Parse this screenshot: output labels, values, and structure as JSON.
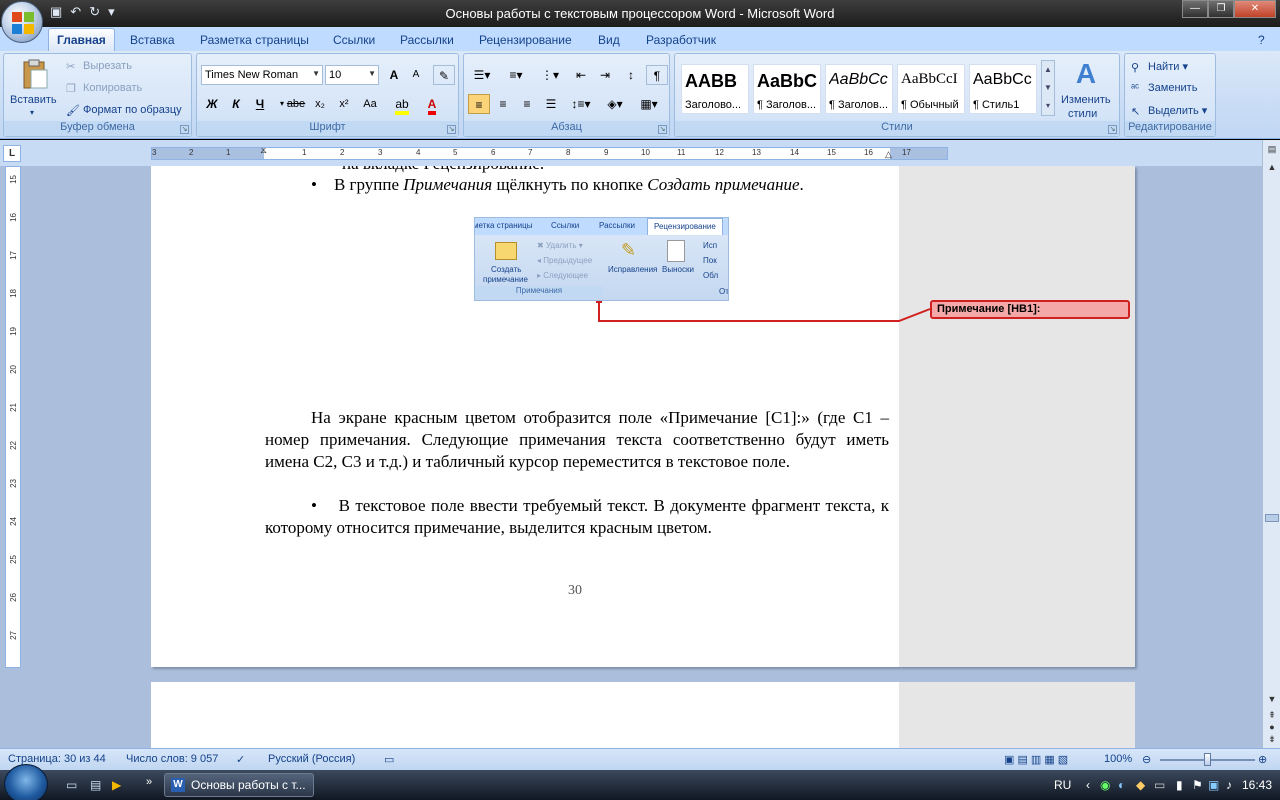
{
  "window": {
    "title": "Основы работы с текстовым процессором Word - Microsoft Word",
    "controls": {
      "minimize": "—",
      "maximize": "❐",
      "close": "✕"
    }
  },
  "ribbon": {
    "tabs": [
      "Главная",
      "Вставка",
      "Разметка страницы",
      "Ссылки",
      "Рассылки",
      "Рецензирование",
      "Вид",
      "Разработчик"
    ],
    "active_tab": "Главная",
    "clipboard": {
      "paste": "Вставить",
      "cut": "Вырезать",
      "copy": "Копировать",
      "format_painter": "Формат по образцу",
      "label": "Буфер обмена"
    },
    "font": {
      "font_name": "Times New Roman",
      "font_size": "10",
      "bold": "Ж",
      "italic": "К",
      "underline": "Ч",
      "strike": "abe",
      "subscript": "x₂",
      "superscript": "x²",
      "change_case": "Aa",
      "grow": "A",
      "shrink": "A",
      "label": "Шрифт"
    },
    "paragraph": {
      "label": "Абзац"
    },
    "styles": {
      "items": [
        {
          "preview": "AABB",
          "caption": "Заголово..."
        },
        {
          "preview": "AaBbC",
          "caption": "¶ Заголов..."
        },
        {
          "preview": "AaBbCc",
          "caption": "¶ Заголов..."
        },
        {
          "preview": "AaBbCcI",
          "caption": "¶ Обычный"
        },
        {
          "preview": "AaBbCc",
          "caption": "¶ Стиль1"
        }
      ],
      "change_styles_1": "Изменить",
      "change_styles_2": "стили",
      "label": "Стили"
    },
    "editing": {
      "find": "Найти",
      "replace": "Заменить",
      "select": "Выделить",
      "label": "Редактирование"
    }
  },
  "ruler": {
    "corner": "L",
    "ticks": [
      "3",
      "2",
      "1",
      "1",
      "2",
      "3",
      "4",
      "5",
      "6",
      "7",
      "8",
      "9",
      "10",
      "11",
      "12",
      "13",
      "14",
      "15",
      "16",
      "17"
    ],
    "vticks": [
      "15",
      "16",
      "17",
      "18",
      "19",
      "20",
      "21",
      "22",
      "23",
      "24",
      "25",
      "26",
      "27"
    ]
  },
  "document": {
    "cut_line": "на вкладке Рецензирование.",
    "bullet1_prefix": "В группе ",
    "bullet1_group": "Примечания",
    "bullet1_mid": " щёлкнуть по кнопке ",
    "bullet1_button": "Создать примечание",
    "bullet1_end": ".",
    "paragraph": "На экране красным цветом отобразится поле «Примечание [С1]:» (где С1 – номер примечания. Следующие примечания текста соответственно будут иметь имена С2, С3 и т.д.) и табличный курсор переместится в текстовое поле.",
    "bullet2": "В текстовое поле ввести требуемый текст. В документе фрагмент текста, к которому относится примечание, выделится красным цветом.",
    "page_number": "30",
    "bullet_glyph": "•"
  },
  "embedded_ribbon": {
    "tabs": [
      "метка страницы",
      "Ссылки",
      "Рассылки",
      "Рецензирование"
    ],
    "create_1": "Создать",
    "create_2": "примечание",
    "delete": "Удалить",
    "previous": "Предыдущее",
    "next": "Следующее",
    "group": "Примечания",
    "track": "Исправления",
    "balloons": "Выноски",
    "cut1": "Исп",
    "cut2": "Пок",
    "cut3": "Обл",
    "cut4": "От"
  },
  "comment": {
    "label": "Примечание [НВ1]:"
  },
  "statusbar": {
    "page": "Страница: 30 из 44",
    "words": "Число слов: 9 057",
    "language": "Русский (Россия)",
    "zoom": "100%"
  },
  "taskbar": {
    "task": "Основы работы с т...",
    "lang": "RU",
    "clock": "16:43"
  },
  "colors": {
    "comment_border": "#d12020",
    "comment_fill": "#f5a8a8",
    "ribbon_bg": "#c7dbf5"
  }
}
